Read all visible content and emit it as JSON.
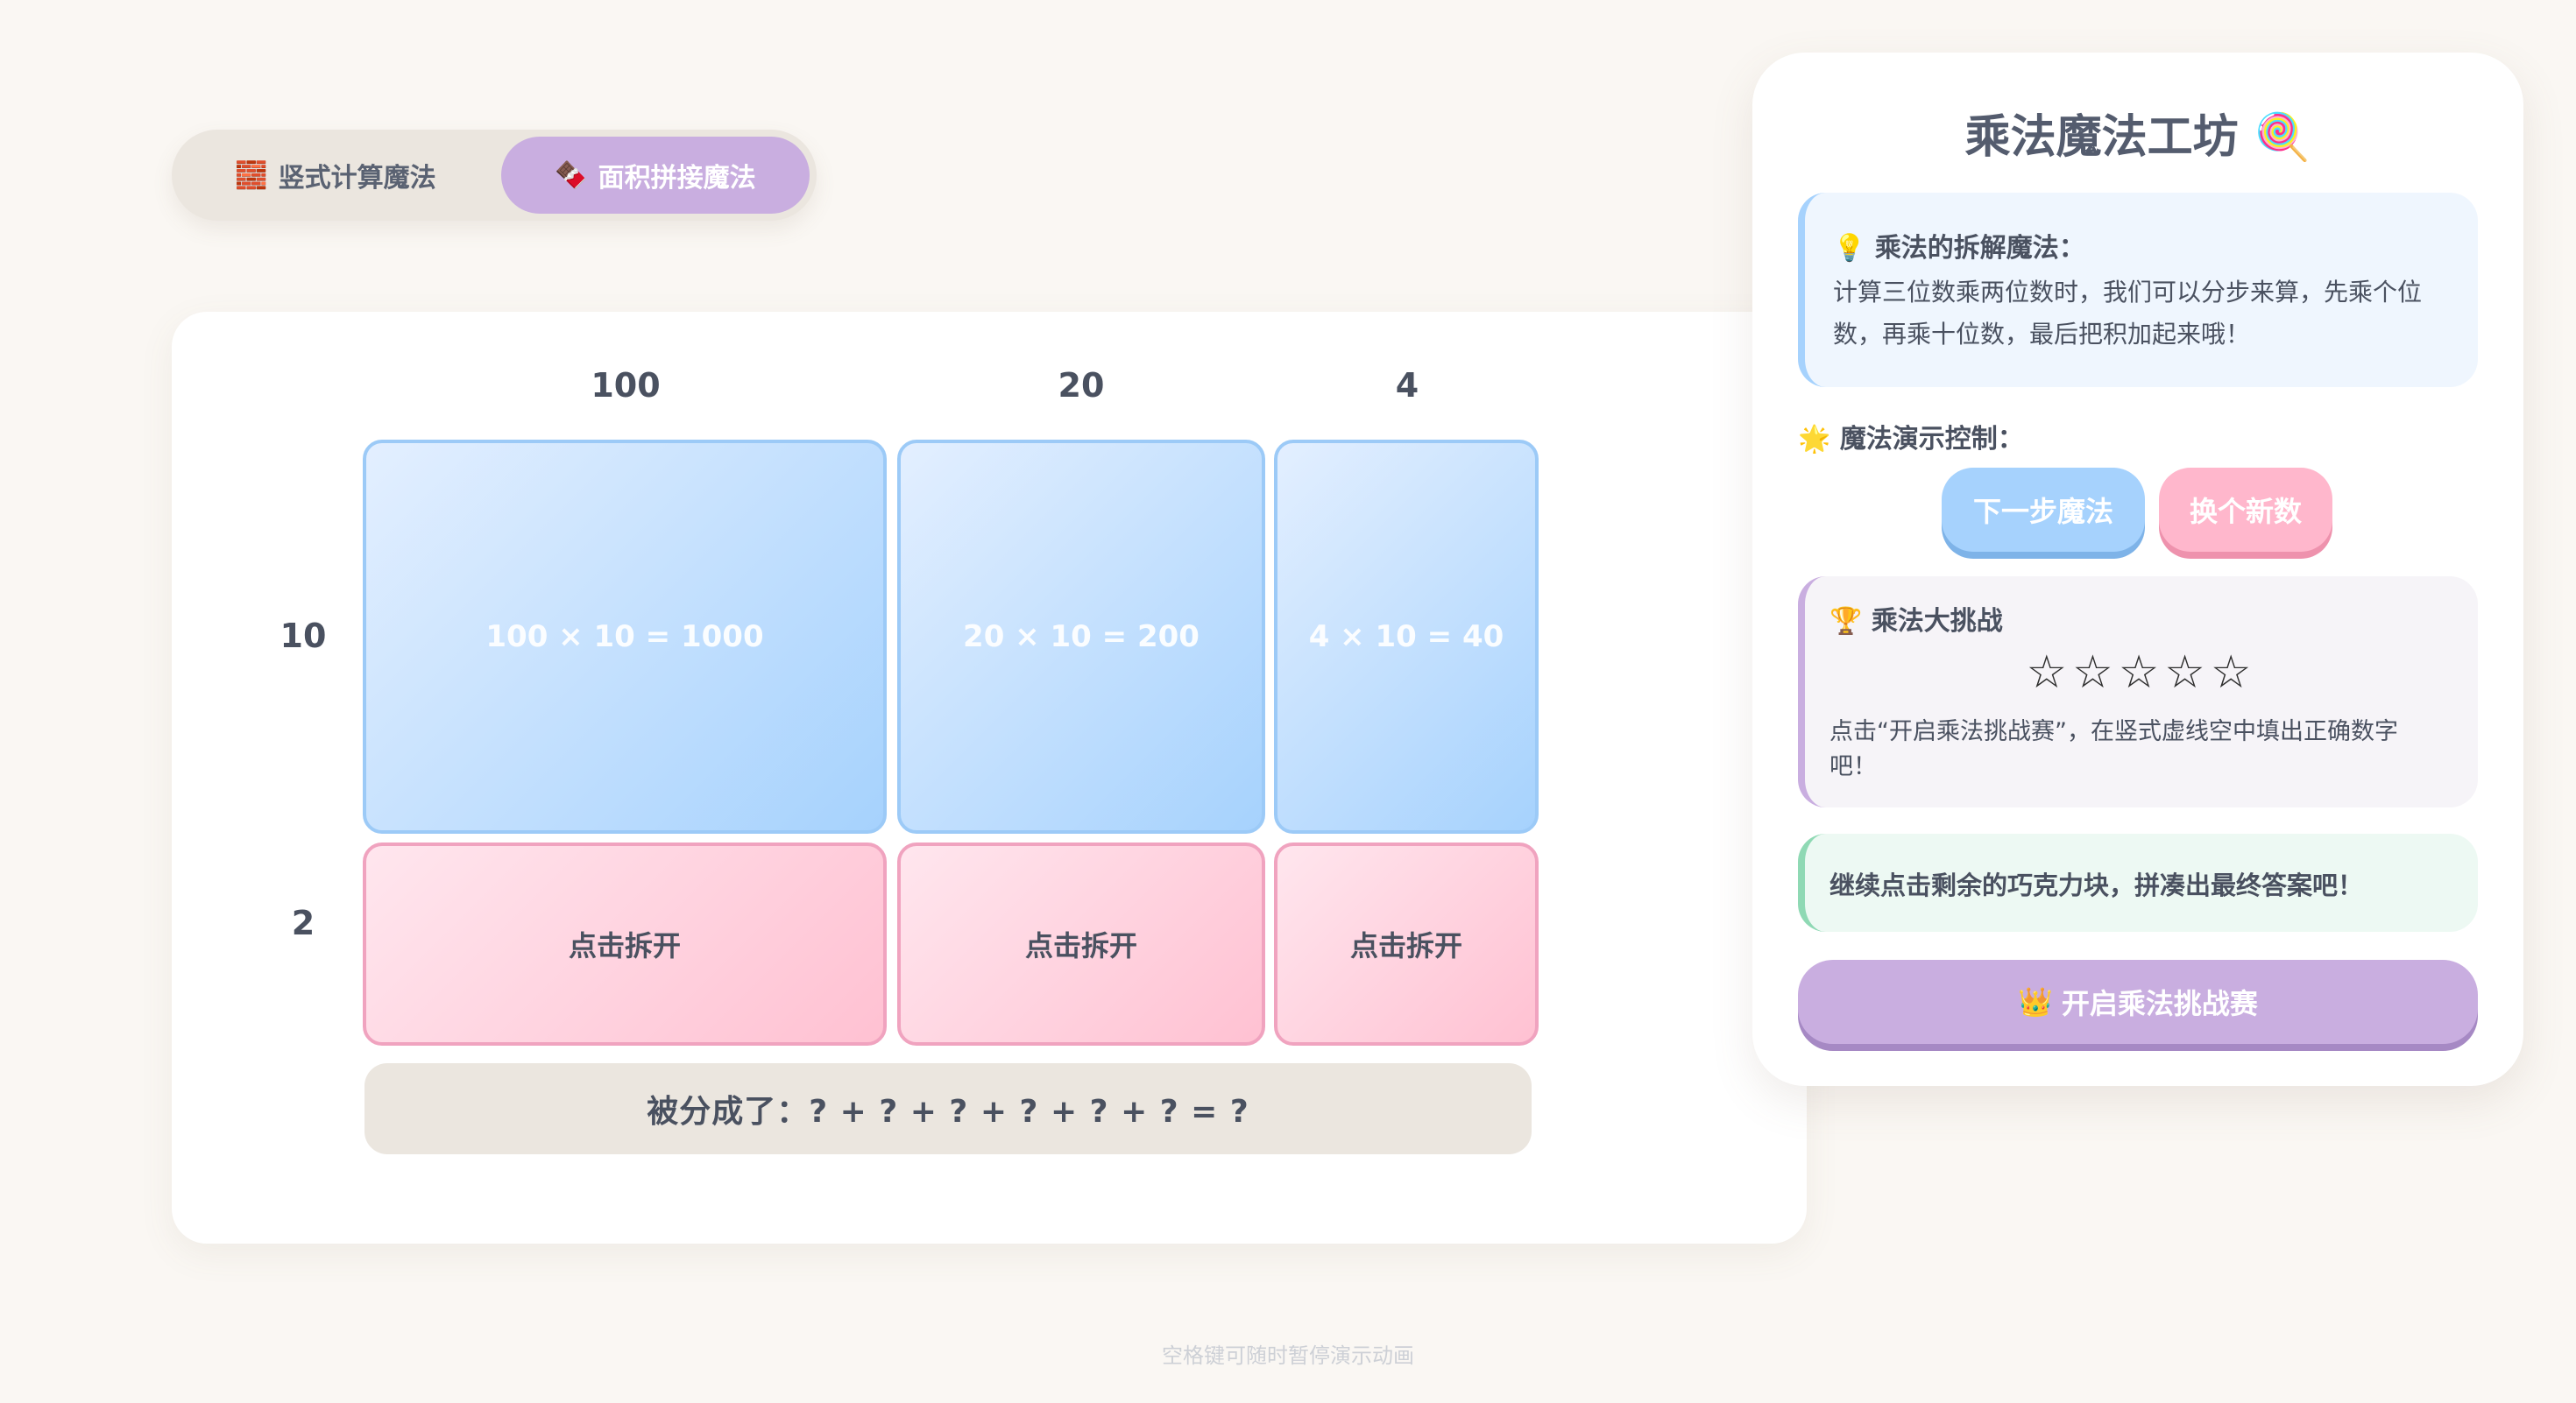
{
  "mode_switch": {
    "vertical": {
      "icon": "🧱",
      "label": "竖式计算魔法"
    },
    "area": {
      "icon": "🍫",
      "label": "面积拼接魔法"
    }
  },
  "board": {
    "columns": [
      "100",
      "20",
      "4"
    ],
    "rows": [
      "10",
      "2"
    ],
    "cells_row1": [
      "100 × 10 = 1000",
      "20 × 10 = 200",
      "4 × 10 = 40"
    ],
    "cells_row2": [
      "点击拆开",
      "点击拆开",
      "点击拆开"
    ],
    "sum_text": "被分成了：? + ? + ? + ? + ? + ? = ?"
  },
  "panel": {
    "title": "乘法魔法工坊",
    "title_icon": "🍭",
    "tip": {
      "icon": "💡",
      "heading": "乘法的拆解魔法：",
      "text": "计算三位数乘两位数时，我们可以分步来算，先乘个位数，再乘十位数，最后把积加起来哦！"
    },
    "controls": {
      "icon": "🌟",
      "label": "魔法演示控制：",
      "next": "下一步魔法",
      "renew": "换个新数"
    },
    "challenge": {
      "icon": "🏆",
      "heading": "乘法大挑战",
      "stars": "☆☆☆☆☆",
      "text": "点击“开启乘法挑战赛”，在竖式虚线空中填出正确数字吧！"
    },
    "hint": "继续点击剩余的巧克力块，拼凑出最终答案吧！",
    "start": {
      "icon": "👑",
      "label": "开启乘法挑战赛"
    }
  },
  "footer": "空格键可随时暂停演示动画"
}
